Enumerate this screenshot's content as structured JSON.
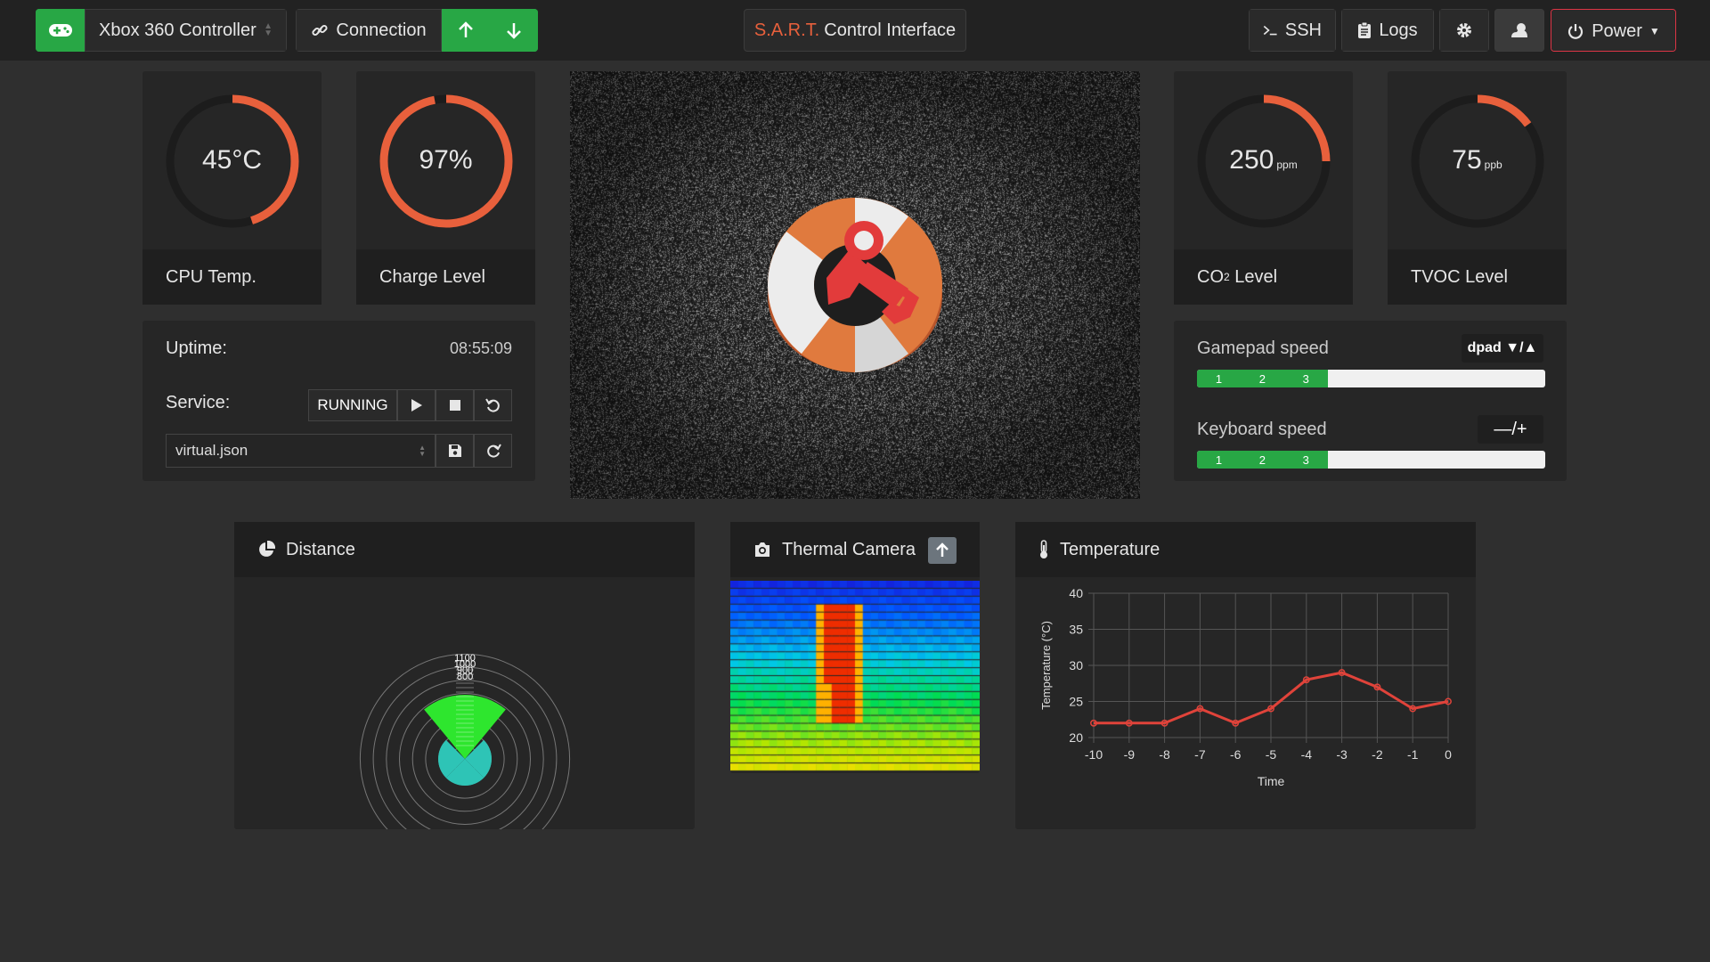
{
  "topbar": {
    "controller_label": "Xbox 360 Controller",
    "connection_label": "Connection",
    "title_accent": "S.A.R.T.",
    "title_rest": "Control Interface",
    "ssh_label": "SSH",
    "logs_label": "Logs",
    "power_label": "Power"
  },
  "gauges": [
    {
      "value": "45°C",
      "unit": "",
      "label": "CPU Temp.",
      "fraction": 0.45
    },
    {
      "value": "97%",
      "unit": "",
      "label": "Charge Level",
      "fraction": 0.97
    },
    {
      "value": "250",
      "unit": "ppm",
      "label_main": "CO",
      "label_sub": "2",
      "label_tail": " Level",
      "fraction": 0.25
    },
    {
      "value": "75",
      "unit": "ppb",
      "label": "TVOC Level",
      "fraction": 0.15
    }
  ],
  "status": {
    "uptime_label": "Uptime:",
    "uptime_value": "08:55:09",
    "service_label": "Service:",
    "service_state": "RUNNING",
    "config_file": "virtual.json"
  },
  "speeds": {
    "gamepad_label": "Gamepad speed",
    "gamepad_control": "dpad ▼/▲",
    "keyboard_label": "Keyboard speed",
    "keyboard_control": "—/+",
    "segments": [
      "1",
      "2",
      "3"
    ],
    "gamepad_level": 0.375,
    "keyboard_level": 0.375
  },
  "panels": {
    "distance_title": "Distance",
    "thermal_title": "Thermal Camera",
    "temperature_title": "Temperature"
  },
  "radar": {
    "ring_labels": [
      "1100",
      "1000",
      "900",
      "800"
    ]
  },
  "colors": {
    "accent": "#e8603c",
    "green": "#28a745",
    "danger": "#dc3545"
  },
  "chart_data": {
    "type": "line",
    "x": [
      -10,
      -9,
      -8,
      -7,
      -6,
      -5,
      -4,
      -3,
      -2,
      -1,
      0
    ],
    "values": [
      22,
      22,
      22,
      24,
      22,
      24,
      28,
      29,
      27,
      24,
      25
    ],
    "xlabel": "Time",
    "ylabel": "Temperature (°C)",
    "ylim": [
      20,
      40
    ],
    "yticks": [
      20,
      25,
      30,
      35,
      40
    ],
    "grid": true,
    "color": "#e0433a"
  }
}
